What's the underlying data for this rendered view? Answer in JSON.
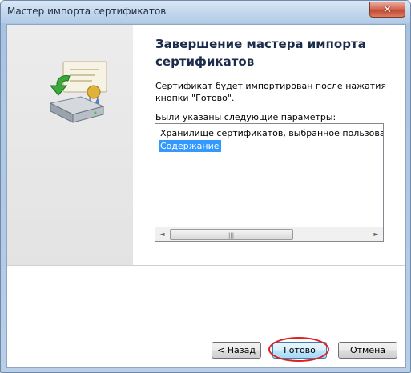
{
  "window": {
    "title": "Мастер импорта сертификатов"
  },
  "titlebar": {
    "close_glyph": "✕"
  },
  "page": {
    "heading_line1": "Завершение мастера импорта",
    "heading_line2": "сертификатов",
    "description_line1": "Сертификат будет импортирован после нажатия",
    "description_line2": "кнопки \"Готово\".",
    "params_label": "Были указаны следующие параметры:"
  },
  "listbox": {
    "items": [
      {
        "label": "Хранилище сертификатов, выбранное пользователем",
        "selected": false
      },
      {
        "label": "Содержание",
        "selected": true
      }
    ],
    "scroll_left": "◄",
    "scroll_right": "►",
    "grip": "|||"
  },
  "buttons": {
    "back": "< Назад",
    "finish": "Готово",
    "cancel": "Отмена"
  },
  "colors": {
    "selection": "#3399ff",
    "annotation": "#e02020"
  }
}
